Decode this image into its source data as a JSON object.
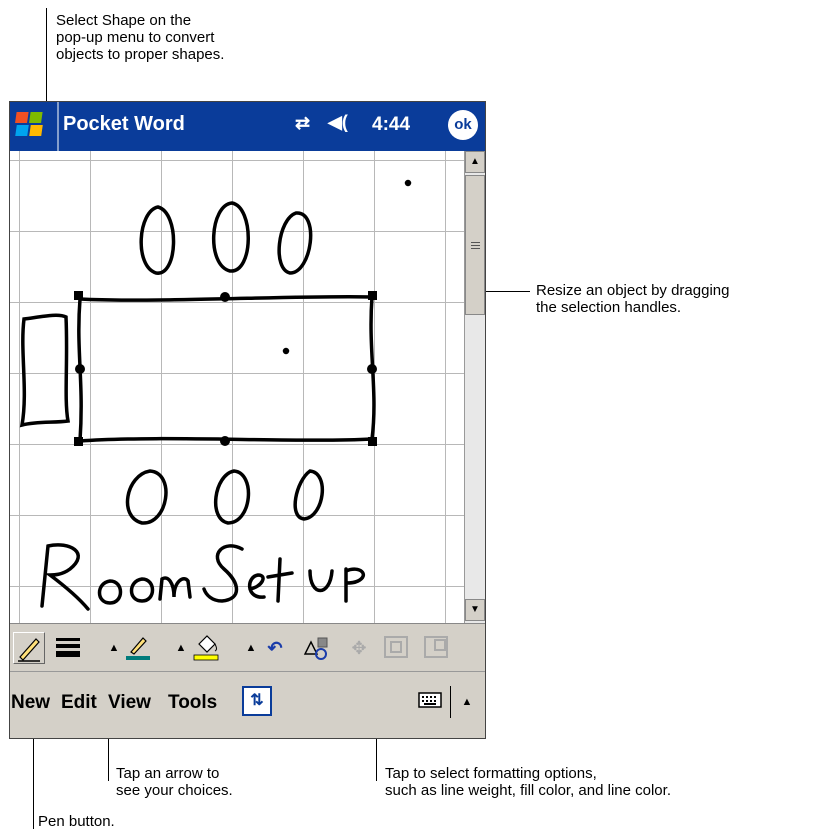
{
  "callouts": {
    "shape_tip": "Select Shape on the\npop-up menu to convert\nobjects to proper shapes.",
    "resize_tip": "Resize an object by dragging\nthe selection handles.",
    "arrow_tip": "Tap an arrow to\nsee your choices.",
    "format_tip": "Tap to select formatting options,\nsuch as line weight, fill color, and line color.",
    "pen_tip": "Pen button."
  },
  "device": {
    "app_title": "Pocket Word",
    "clock": "4:44",
    "ok_label": "ok",
    "handwriting": "Room Set UP",
    "menus": [
      "New",
      "Edit",
      "View",
      "Tools"
    ],
    "icons": [
      "windows-start-icon",
      "connectivity-icon",
      "speaker-icon",
      "pen-icon",
      "line-weight-icon",
      "line-color-icon",
      "fill-color-icon",
      "undo-icon",
      "shape-format-icon",
      "align-icon",
      "group-icon",
      "ungroup-icon",
      "toggle-mode-icon",
      "keyboard-icon"
    ],
    "colors": {
      "titlebar": "#0a3c9a",
      "chrome": "#d4d0c8",
      "grid": "#b8b8b8",
      "line_color_swatch": "#007b7b",
      "fill_color_swatch": "#ffff00"
    }
  }
}
